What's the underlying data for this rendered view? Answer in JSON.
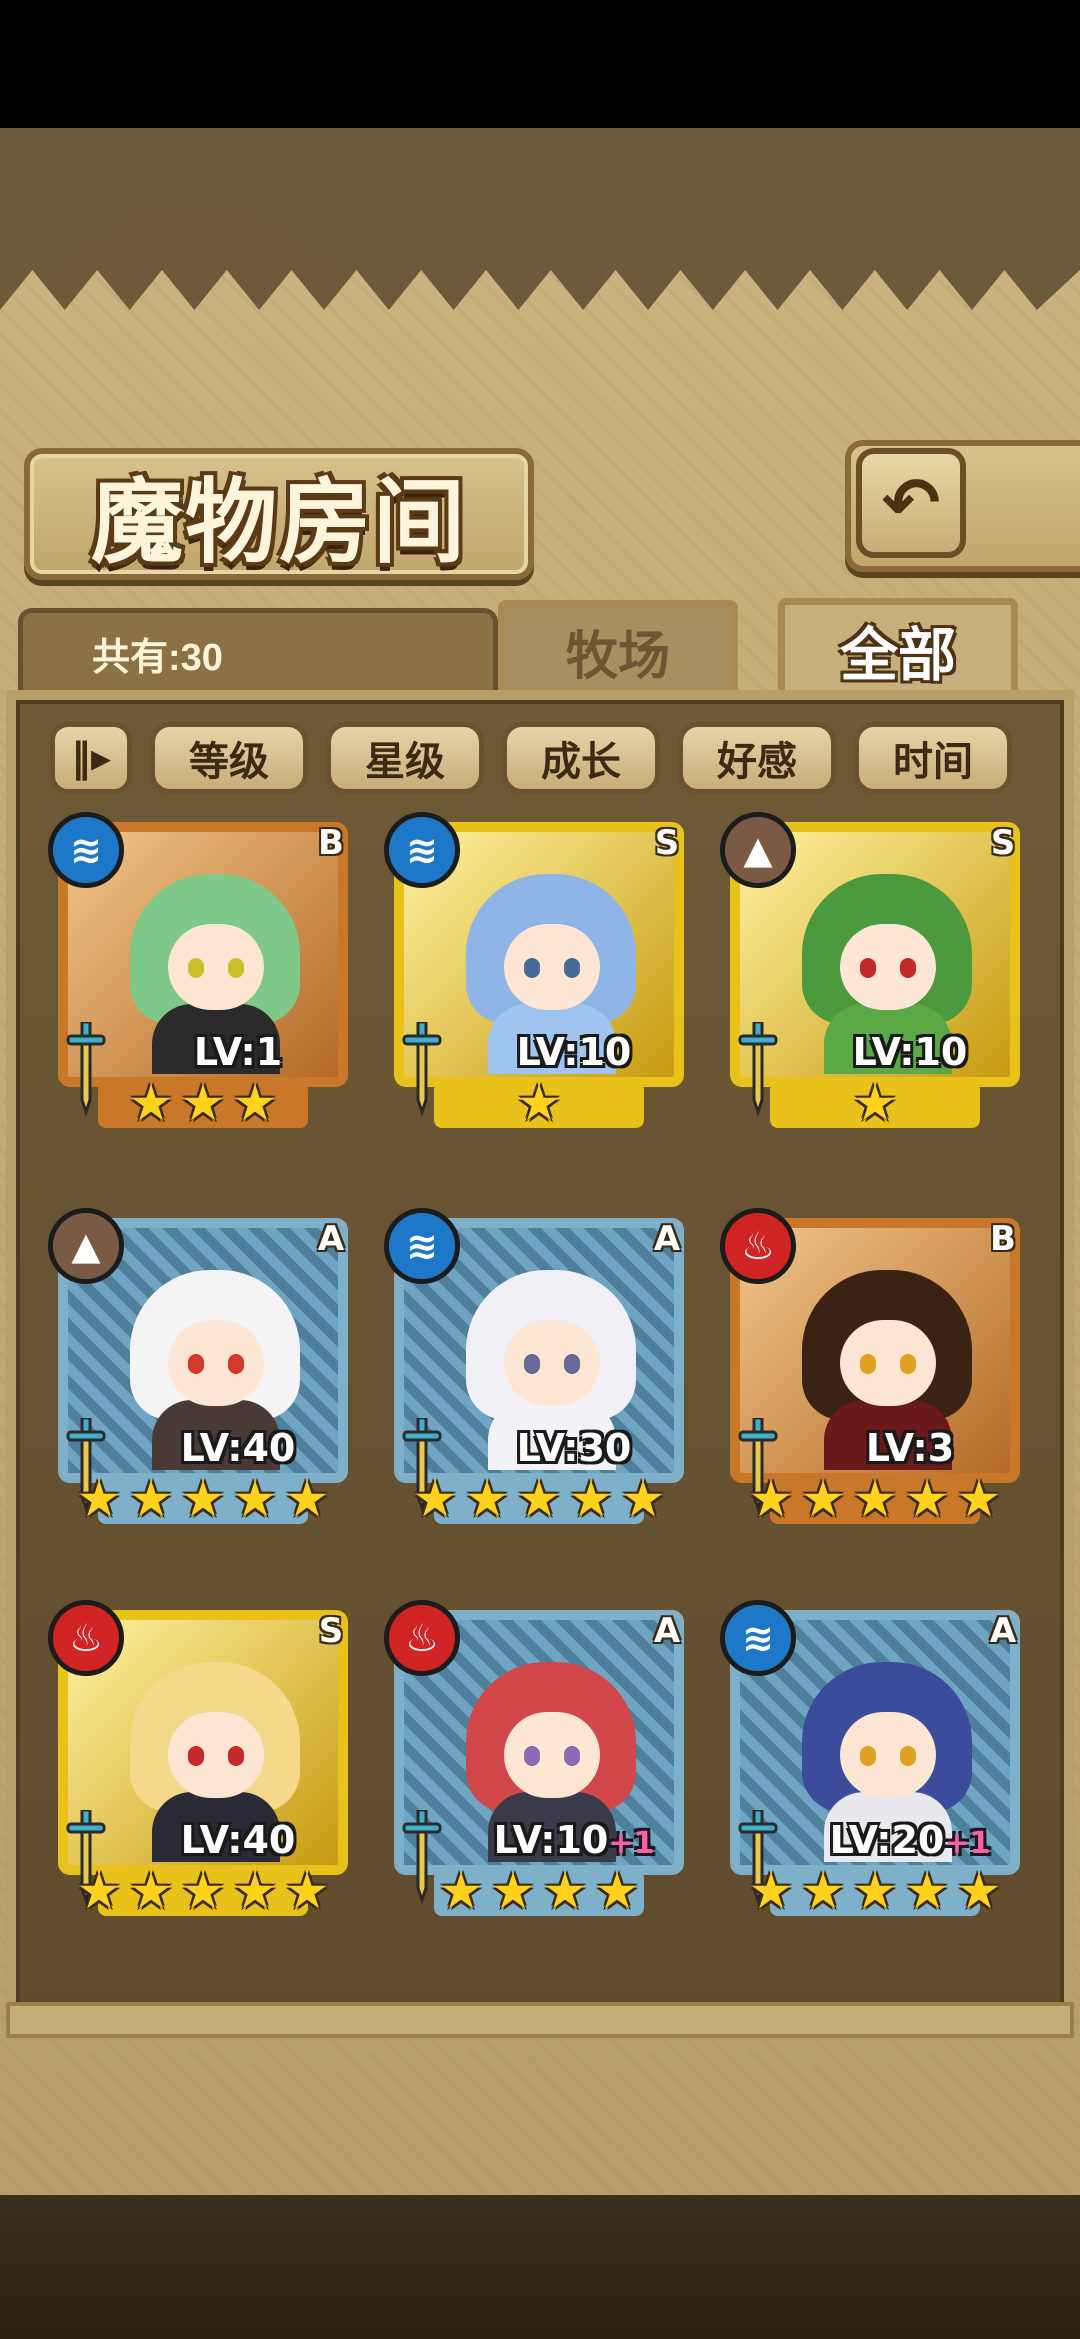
{
  "title": "魔物房间",
  "back_icon": "return-arrow-icon",
  "count_label": "共有:30",
  "tabs": [
    {
      "label": "牧场"
    },
    {
      "label": "全部"
    }
  ],
  "sort_toggle_icon": "sort-order-icon",
  "sort_buttons": [
    {
      "label": "等级"
    },
    {
      "label": "星级"
    },
    {
      "label": "成长"
    },
    {
      "label": "好感"
    },
    {
      "label": "时间"
    }
  ],
  "monsters": [
    {
      "element": "water",
      "rank": "B",
      "level": "LV:1",
      "plus": "",
      "stars": 3,
      "frame": "bronze",
      "hair": "#7ec98a",
      "outfit": "#2b2b2b",
      "eye": "#c9c12a"
    },
    {
      "element": "water",
      "rank": "S",
      "level": "LV:10",
      "plus": "",
      "stars": 1,
      "frame": "gold",
      "hair": "#8fb4e6",
      "outfit": "#9fc4ef",
      "eye": "#4a6a96"
    },
    {
      "element": "earth",
      "rank": "S",
      "level": "LV:10",
      "plus": "",
      "stars": 1,
      "frame": "gold",
      "hair": "#4b9a3e",
      "outfit": "#5aa846",
      "eye": "#c42a2a"
    },
    {
      "element": "earth",
      "rank": "A",
      "level": "LV:40",
      "plus": "",
      "stars": 5,
      "frame": "silver",
      "hair": "#f4f4f4",
      "outfit": "#4a3a36",
      "eye": "#d23a2a"
    },
    {
      "element": "water",
      "rank": "A",
      "level": "LV:30",
      "plus": "",
      "stars": 5,
      "frame": "silver",
      "hair": "#f0f0f6",
      "outfit": "#f2f2f8",
      "eye": "#6a6a9a"
    },
    {
      "element": "fire",
      "rank": "B",
      "level": "LV:3",
      "plus": "",
      "stars": 5,
      "frame": "bronze",
      "hair": "#3a2214",
      "outfit": "#6a1a1a",
      "eye": "#e0a020"
    },
    {
      "element": "fire",
      "rank": "S",
      "level": "LV:40",
      "plus": "",
      "stars": 5,
      "frame": "gold",
      "hair": "#f5d98a",
      "outfit": "#2a2a36",
      "eye": "#c42a2a"
    },
    {
      "element": "fire",
      "rank": "A",
      "level": "LV:10",
      "plus": "+1",
      "stars": 4,
      "frame": "silver",
      "hair": "#d2484a",
      "outfit": "#3a3a4a",
      "eye": "#8a6ab0"
    },
    {
      "element": "water",
      "rank": "A",
      "level": "LV:20",
      "plus": "+1",
      "stars": 5,
      "frame": "silver",
      "hair": "#3a4c9a",
      "outfit": "#e8e8ee",
      "eye": "#e0a020"
    }
  ]
}
